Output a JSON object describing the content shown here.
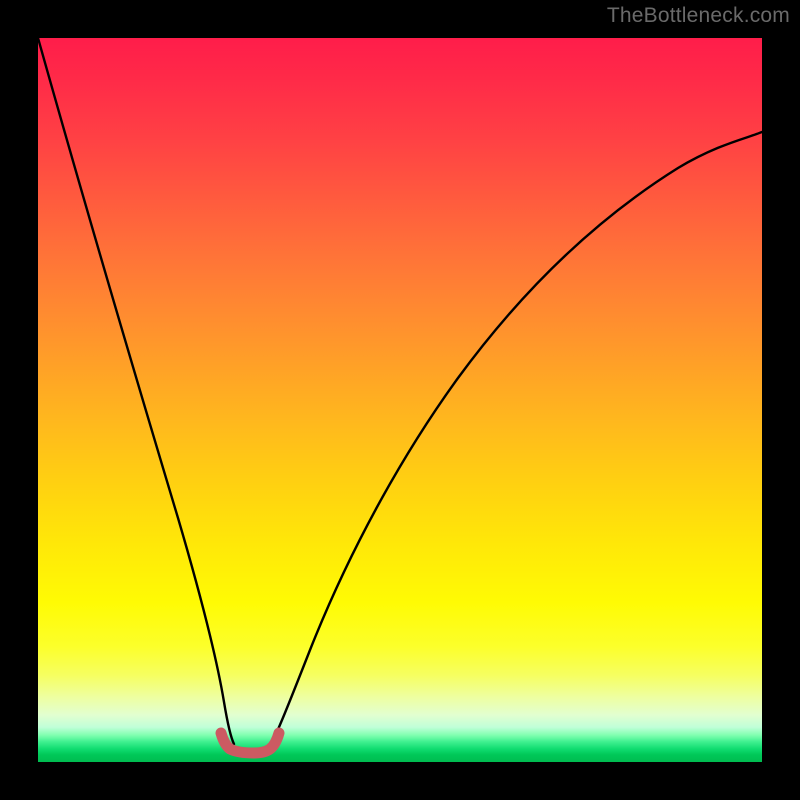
{
  "watermark": "TheBottleneck.com",
  "chart_data": {
    "type": "line",
    "title": "",
    "xlabel": "",
    "ylabel": "",
    "xlim": [
      0,
      1
    ],
    "ylim": [
      0,
      1
    ],
    "note": "No axes, tick labels, or data labels are rendered; values are estimated from pixel positions (y measured from bottom, x from left, both normalised to the plot area).",
    "series": [
      {
        "name": "left-branch",
        "x": [
          0.0,
          0.05,
          0.1,
          0.15,
          0.2,
          0.23,
          0.252,
          0.26,
          0.27
        ],
        "y": [
          1.0,
          0.8,
          0.6,
          0.4,
          0.2,
          0.08,
          0.025,
          0.015,
          0.013
        ]
      },
      {
        "name": "right-branch",
        "x": [
          0.31,
          0.322,
          0.345,
          0.4,
          0.5,
          0.6,
          0.7,
          0.8,
          0.9,
          1.0
        ],
        "y": [
          0.013,
          0.02,
          0.06,
          0.19,
          0.39,
          0.54,
          0.66,
          0.745,
          0.815,
          0.87
        ]
      },
      {
        "name": "pink-trough",
        "x": [
          0.252,
          0.258,
          0.265,
          0.275,
          0.29,
          0.305,
          0.315,
          0.322,
          0.328
        ],
        "y": [
          0.025,
          0.017,
          0.014,
          0.013,
          0.013,
          0.013,
          0.014,
          0.02,
          0.03
        ]
      }
    ],
    "colors": {
      "curve": "#000000",
      "trough": "#cc5a62",
      "gradient_top": "#ff1d4a",
      "gradient_bottom": "#00bc50"
    }
  }
}
